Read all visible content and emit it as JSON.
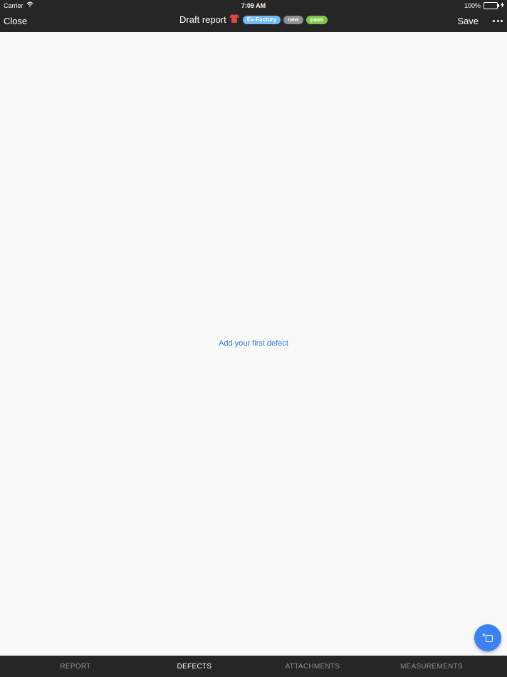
{
  "status_bar": {
    "carrier": "Carrier",
    "time": "7:09 AM",
    "battery": "100%",
    "wifi_icon": "wifi-icon",
    "battery_icon": "battery-icon",
    "charging_icon": "lightning-icon"
  },
  "navbar": {
    "close_label": "Close",
    "title": "Draft report",
    "shirt_icon": "shirt-icon",
    "tags": [
      {
        "label": "Ex-Factory",
        "color": "#6fb9ff"
      },
      {
        "label": "new",
        "color": "#8e8e93"
      },
      {
        "label": "pass",
        "color": "#7ec64a"
      }
    ],
    "save_label": "Save",
    "more_icon": "more-icon"
  },
  "main": {
    "empty_cta": "Add your first defect"
  },
  "fab": {
    "icon": "add-defect-icon"
  },
  "tabs": [
    {
      "label": "REPORT",
      "active": false
    },
    {
      "label": "DEFECTS",
      "active": true
    },
    {
      "label": "ATTACHMENTS",
      "active": false
    },
    {
      "label": "MEASUREMENTS",
      "active": false
    }
  ],
  "colors": {
    "bar_background": "#262626",
    "content_background": "#f9f9f9",
    "accent": "#3b82f6",
    "link": "#2f79e0"
  }
}
